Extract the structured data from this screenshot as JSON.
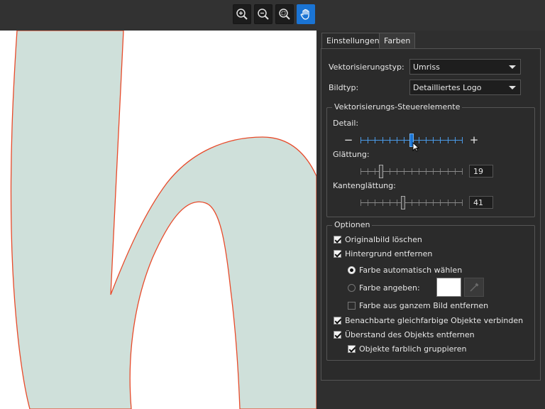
{
  "toolbar": {
    "tools": [
      {
        "icon": "zoom-in-icon"
      },
      {
        "icon": "zoom-out-icon"
      },
      {
        "icon": "zoom-fit-icon"
      },
      {
        "icon": "hand-pan-icon",
        "active": true
      }
    ],
    "active_color": "#1a74d4"
  },
  "tabs": [
    {
      "label": "Einstellungen",
      "active": true
    },
    {
      "label": "Farben",
      "active": false
    }
  ],
  "settings": {
    "vector_type_label": "Vektorisierungstyp:",
    "vector_type_value": "Umriss",
    "image_type_label": "Bildtyp:",
    "image_type_value": "Detailliertes Logo"
  },
  "controls": {
    "title": "Vektorisierungs-Steuerelemente",
    "detail_label": "Detail:",
    "detail_minus": "−",
    "detail_plus": "+",
    "detail_level": 0.5,
    "smoothing_label": "Glättung:",
    "smoothing_value": "19",
    "edge_smoothing_label": "Kantenglättung:",
    "edge_smoothing_value": "41"
  },
  "options": {
    "title": "Optionen",
    "delete_original": {
      "label": "Originalbild löschen",
      "checked": true
    },
    "remove_background": {
      "label": "Hintergrund entfernen",
      "checked": true
    },
    "auto_color": {
      "label": "Farbe automatisch wählen",
      "selected": true
    },
    "specify_color": {
      "label": "Farbe angeben:",
      "selected": false,
      "swatch": "#ffffff"
    },
    "remove_whole_image": {
      "label": "Farbe aus ganzem Bild entfernen",
      "checked": false
    },
    "merge_adjacent": {
      "label": "Benachbarte gleichfarbige Objekte verbinden",
      "checked": true
    },
    "remove_overlap": {
      "label": "Überstand des Objekts entfernen",
      "checked": true
    },
    "group_by_color": {
      "label": "Objekte farblich gruppieren",
      "checked": true
    }
  },
  "canvas": {
    "shape_fill": "#cfe0da",
    "outline_color": "#e84a2a"
  }
}
